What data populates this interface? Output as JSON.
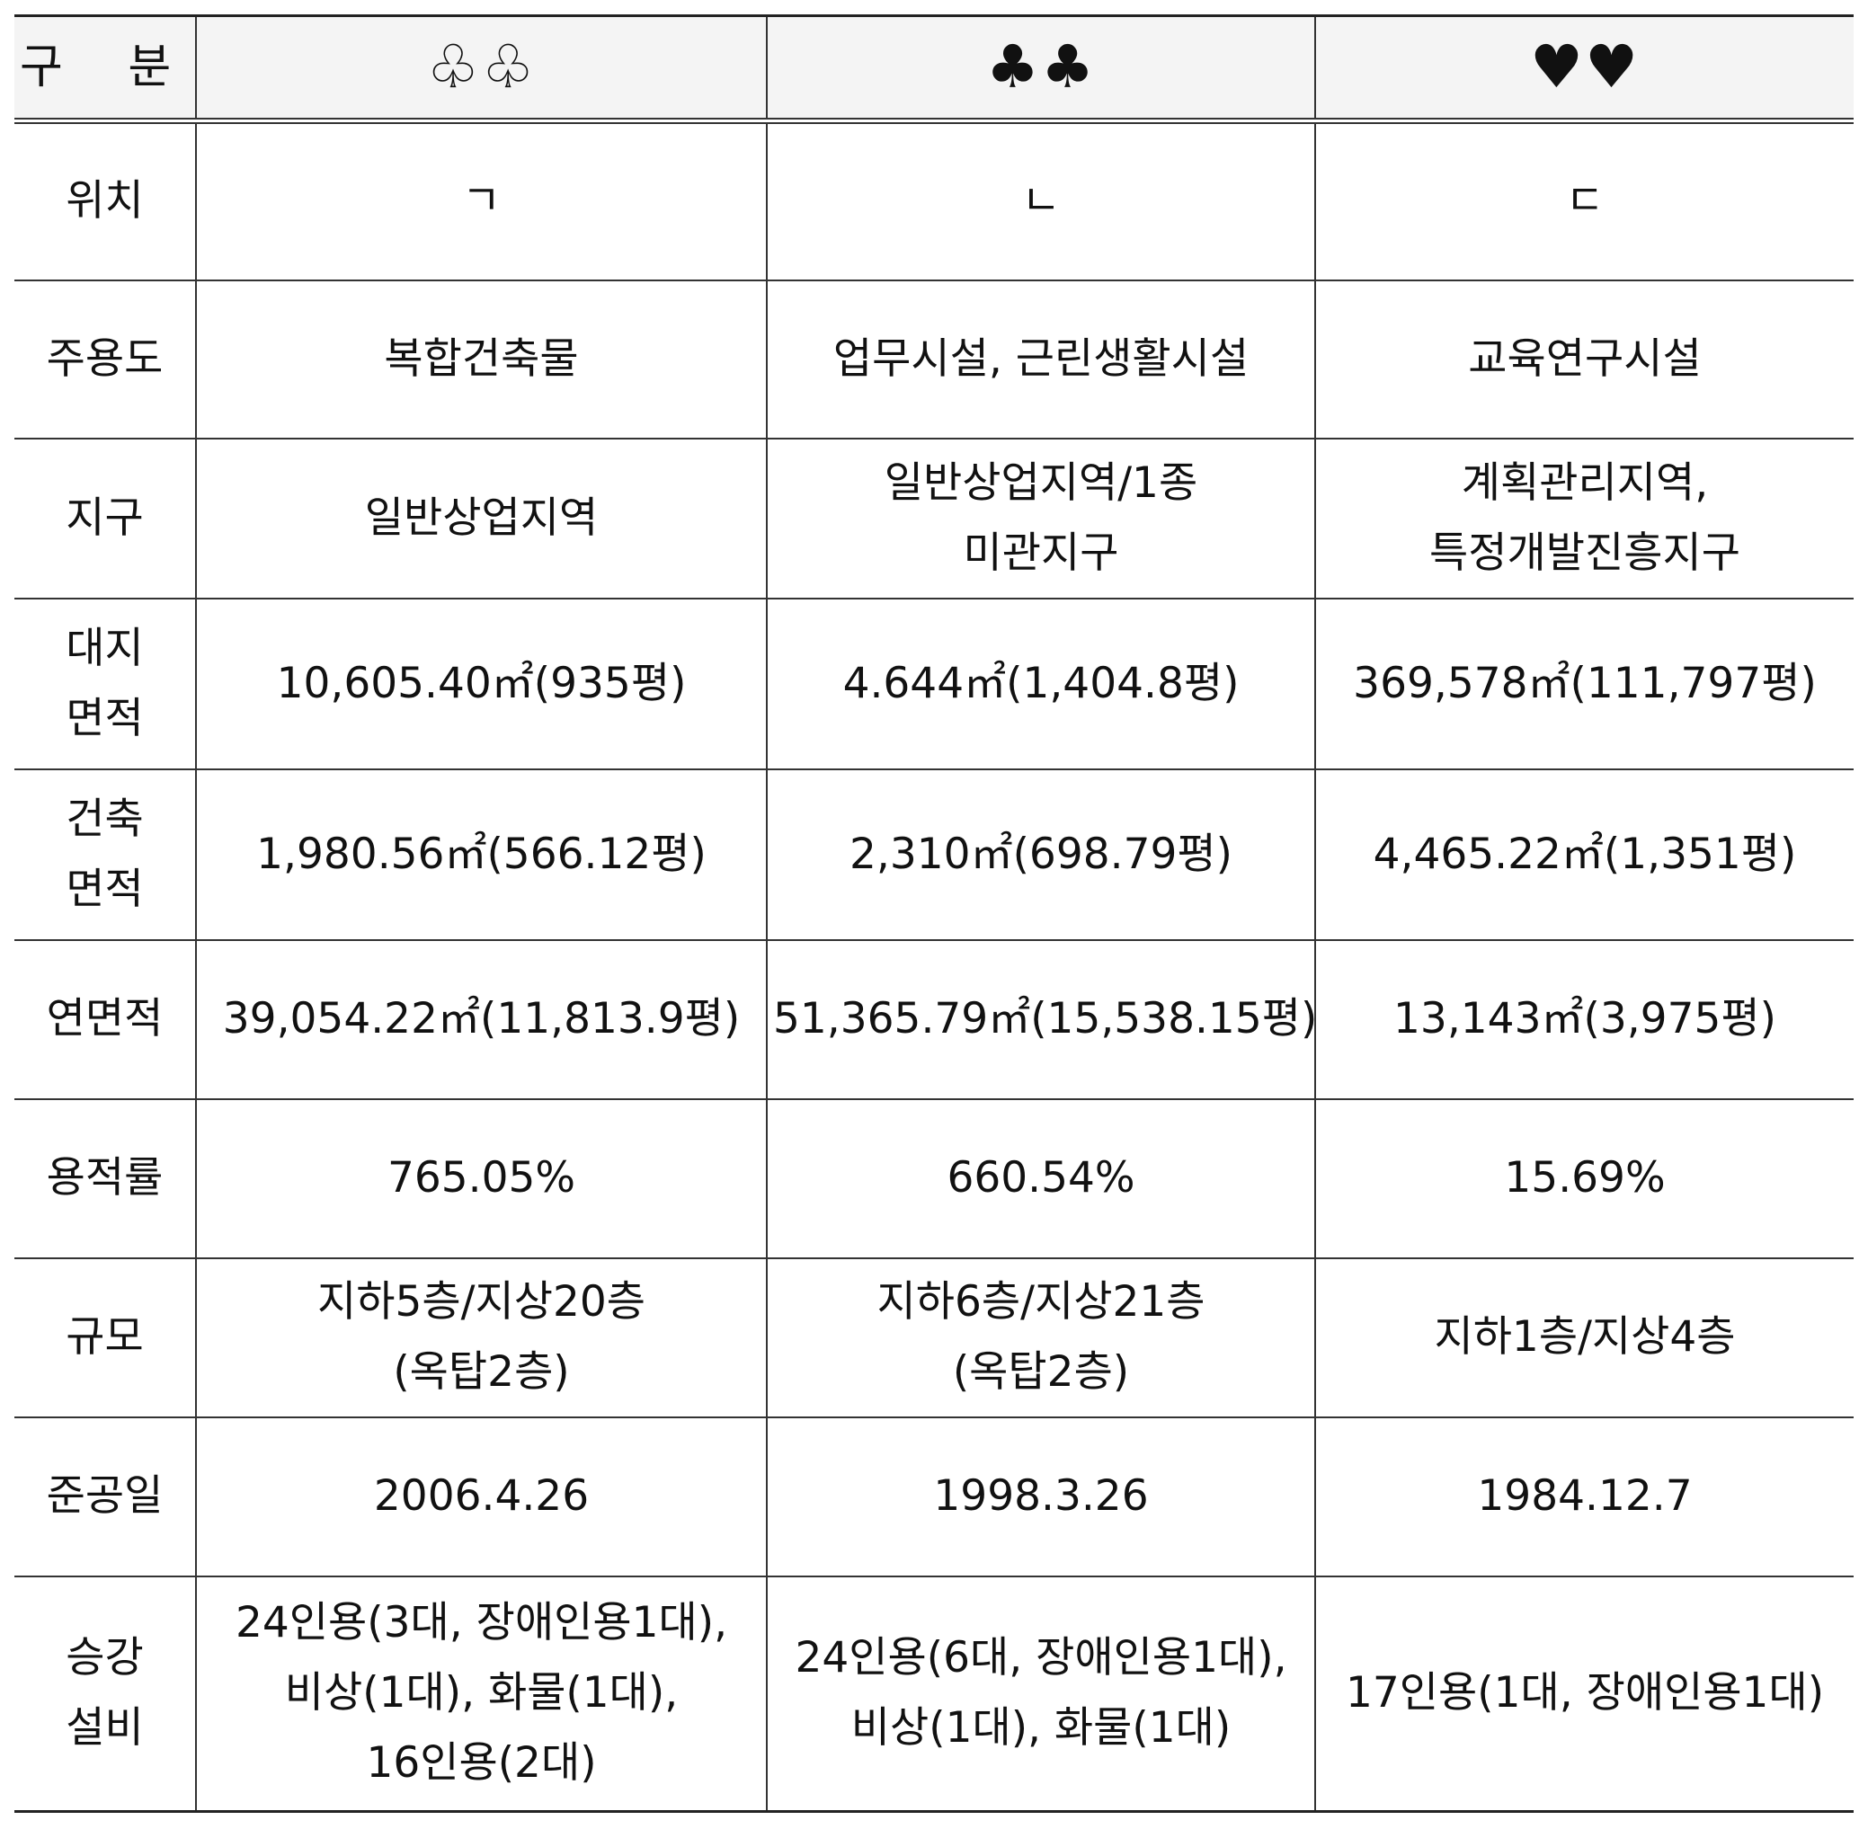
{
  "header": {
    "label": "구 분",
    "col1": "♧♧",
    "col2": "♣♣",
    "col3": "♥♥"
  },
  "rows": [
    {
      "label": [
        "위치"
      ],
      "cells": [
        [
          "ㄱ"
        ],
        [
          "ㄴ"
        ],
        [
          "ㄷ"
        ]
      ]
    },
    {
      "label": [
        "주용도"
      ],
      "cells": [
        [
          "복합건축물"
        ],
        [
          "업무시설, 근린생활시설"
        ],
        [
          "교육연구시설"
        ]
      ]
    },
    {
      "label": [
        "지구"
      ],
      "cells": [
        [
          "일반상업지역"
        ],
        [
          "일반상업지역/1종",
          "미관지구"
        ],
        [
          "계획관리지역,",
          "특정개발진흥지구"
        ]
      ]
    },
    {
      "label": [
        "대지",
        "면적"
      ],
      "cells": [
        [
          "10,605.40㎡(935평)"
        ],
        [
          "4.644㎡(1,404.8평)"
        ],
        [
          "369,578㎡(111,797평)"
        ]
      ]
    },
    {
      "label": [
        "건축",
        "면적"
      ],
      "cells": [
        [
          "1,980.56㎡(566.12평)"
        ],
        [
          "2,310㎡(698.79평)"
        ],
        [
          "4,465.22㎡(1,351평)"
        ]
      ]
    },
    {
      "label": [
        "연면적"
      ],
      "cells": [
        [
          "39,054.22㎡(11,813.9평)"
        ],
        [
          "51,365.79㎡(15,538.15평)"
        ],
        [
          "13,143㎡(3,975평)"
        ]
      ]
    },
    {
      "label": [
        "용적률"
      ],
      "cells": [
        [
          "765.05%"
        ],
        [
          "660.54%"
        ],
        [
          "15.69%"
        ]
      ]
    },
    {
      "label": [
        "규모"
      ],
      "cells": [
        [
          "지하5층/지상20층",
          "(옥탑2층)"
        ],
        [
          "지하6층/지상21층",
          "(옥탑2층)"
        ],
        [
          "지하1층/지상4층"
        ]
      ]
    },
    {
      "label": [
        "준공일"
      ],
      "cells": [
        [
          "2006.4.26"
        ],
        [
          "1998.3.26"
        ],
        [
          "1984.12.7"
        ]
      ]
    },
    {
      "label": [
        "승강",
        "설비"
      ],
      "cells": [
        [
          "24인용(3대, 장애인용1대),",
          "비상(1대), 화물(1대),",
          "16인용(2대)"
        ],
        [
          "24인용(6대, 장애인용1대),",
          "비상(1대), 화물(1대)"
        ],
        [
          "17인용(1대, 장애인용1대)"
        ]
      ]
    }
  ]
}
